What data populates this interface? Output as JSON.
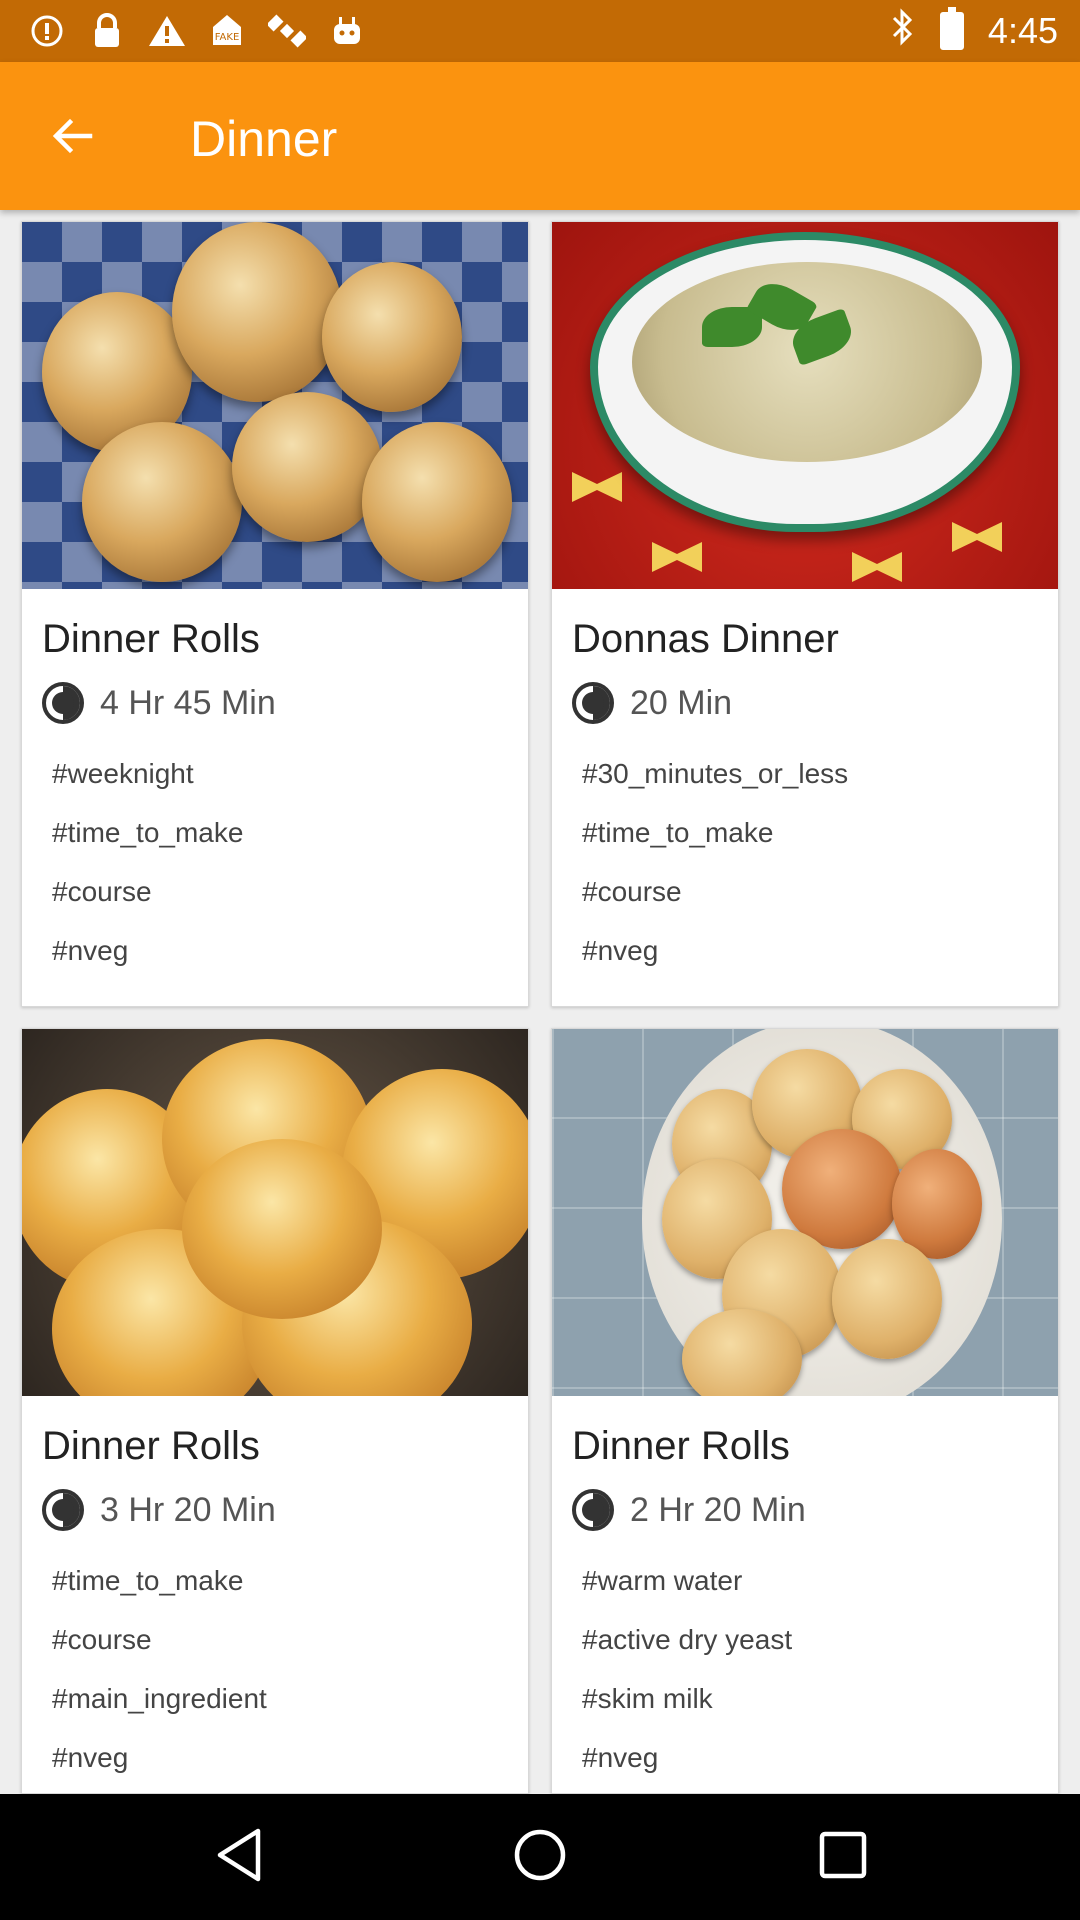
{
  "status_bar": {
    "time": "4:45",
    "left_icons": [
      "alert-circle-icon",
      "lock-icon",
      "warning-icon",
      "fake-gps-icon",
      "satellite-icon",
      "android-icon"
    ],
    "right_icons": [
      "bluetooth-icon",
      "battery-icon"
    ]
  },
  "app_bar": {
    "title": "Dinner",
    "back_icon": "arrow-left-icon",
    "color": "#fb930f"
  },
  "cards": [
    {
      "title": "Dinner Rolls",
      "time": "4 Hr 45 Min",
      "tags": [
        "#weeknight",
        "#time_to_make",
        "#course",
        "#nveg"
      ]
    },
    {
      "title": "Donnas Dinner",
      "time": "20 Min",
      "tags": [
        "#30_minutes_or_less",
        "#time_to_make",
        "#course",
        "#nveg"
      ]
    },
    {
      "title": "Dinner Rolls",
      "time": "3 Hr 20 Min",
      "tags": [
        "#time_to_make",
        "#course",
        "#main_ingredient",
        "#nveg"
      ]
    },
    {
      "title": "Dinner Rolls",
      "time": "2 Hr 20 Min",
      "tags": [
        "#warm water",
        "#active dry yeast",
        "#skim milk",
        "#nveg"
      ]
    }
  ],
  "nav_bar": {
    "icons": [
      "back-triangle-icon",
      "home-circle-icon",
      "recents-square-icon"
    ]
  }
}
